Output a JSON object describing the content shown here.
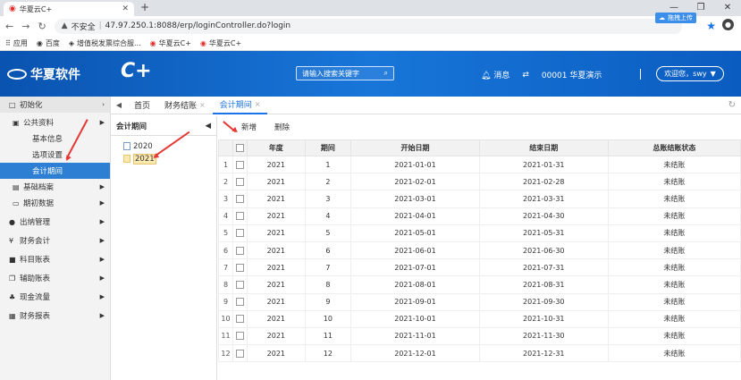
{
  "browser": {
    "tab_title": "华夏云C+",
    "new_tab": "+",
    "url_warning": "不安全",
    "url": "47.97.250.1:8088/erp/loginController.do?login",
    "sync_label": "拖拽上传",
    "bookmarks": [
      "应用",
      "百度",
      "增值税发票综合服...",
      "华夏云C+",
      "华夏云C+"
    ]
  },
  "header": {
    "logo_text": "华夏软件",
    "cplus": "C+",
    "search_placeholder": "请输入搜索关键字",
    "messages": "消息",
    "org": "00001 华夏演示",
    "welcome": "欢迎您，swy"
  },
  "sidebar": {
    "top": "初始化",
    "items": [
      {
        "label": "公共资料",
        "level": 1,
        "arrow": true
      },
      {
        "label": "基本信息",
        "level": 2
      },
      {
        "label": "选项设置",
        "level": 2
      },
      {
        "label": "会计期间",
        "level": 2,
        "active": true
      },
      {
        "label": "基础档案",
        "level": 1,
        "arrow": true
      },
      {
        "label": "期初数据",
        "level": 1,
        "arrow": true
      },
      {
        "label": "出纳管理",
        "level": 0,
        "arrow": true
      },
      {
        "label": "财务会计",
        "level": 0,
        "arrow": true
      },
      {
        "label": "科目账表",
        "level": 0,
        "arrow": true
      },
      {
        "label": "辅助账表",
        "level": 0,
        "arrow": true
      },
      {
        "label": "现金流量",
        "level": 0,
        "arrow": true
      },
      {
        "label": "财务报表",
        "level": 0,
        "arrow": true
      }
    ]
  },
  "tabs": [
    {
      "label": "首页",
      "closable": false
    },
    {
      "label": "财务结账",
      "closable": true
    },
    {
      "label": "会计期间",
      "closable": true,
      "active": true
    }
  ],
  "tree": {
    "title": "会计期间",
    "years": [
      "2020",
      "2021"
    ]
  },
  "toolbar": {
    "add": "新增",
    "delete": "删除"
  },
  "table": {
    "headers": [
      "年度",
      "期间",
      "开始日期",
      "结束日期",
      "总账结账状态"
    ],
    "rows": [
      [
        "2021",
        "1",
        "2021-01-01",
        "2021-01-31",
        "未结账"
      ],
      [
        "2021",
        "2",
        "2021-02-01",
        "2021-02-28",
        "未结账"
      ],
      [
        "2021",
        "3",
        "2021-03-01",
        "2021-03-31",
        "未结账"
      ],
      [
        "2021",
        "4",
        "2021-04-01",
        "2021-04-30",
        "未结账"
      ],
      [
        "2021",
        "5",
        "2021-05-01",
        "2021-05-31",
        "未结账"
      ],
      [
        "2021",
        "6",
        "2021-06-01",
        "2021-06-30",
        "未结账"
      ],
      [
        "2021",
        "7",
        "2021-07-01",
        "2021-07-31",
        "未结账"
      ],
      [
        "2021",
        "8",
        "2021-08-01",
        "2021-08-31",
        "未结账"
      ],
      [
        "2021",
        "9",
        "2021-09-01",
        "2021-09-30",
        "未结账"
      ],
      [
        "2021",
        "10",
        "2021-10-01",
        "2021-10-31",
        "未结账"
      ],
      [
        "2021",
        "11",
        "2021-11-01",
        "2021-11-30",
        "未结账"
      ],
      [
        "2021",
        "12",
        "2021-12-01",
        "2021-12-31",
        "未结账"
      ]
    ]
  }
}
